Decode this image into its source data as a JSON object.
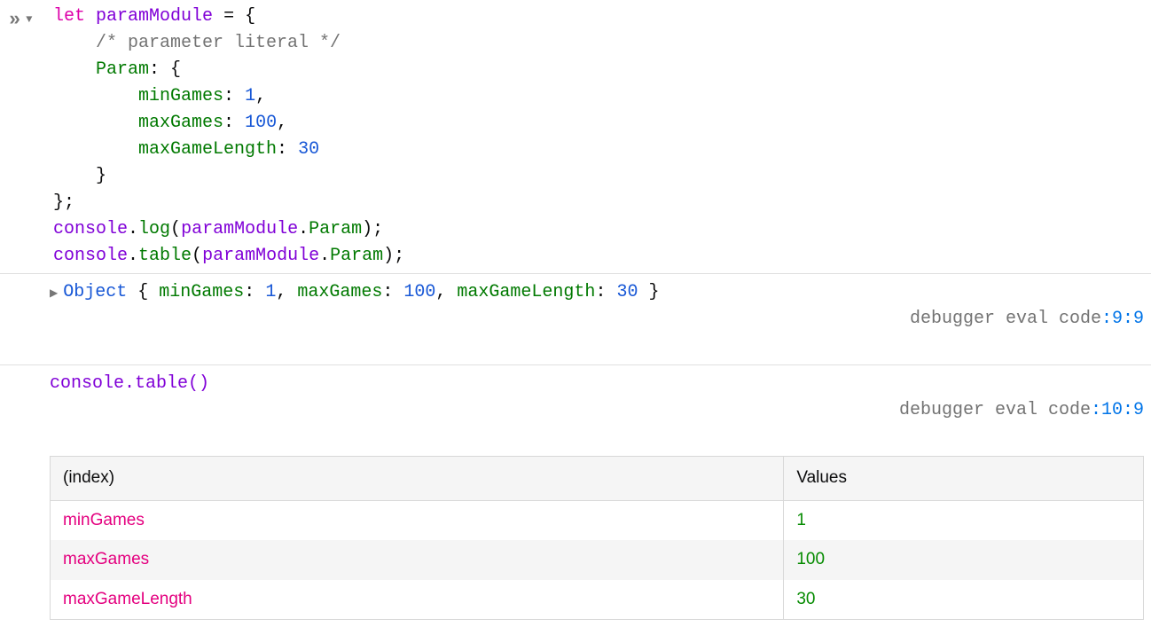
{
  "input": {
    "code_html": "<span class=\"kw\">let</span> <span class=\"var\">paramModule</span> <span class=\"punct\">= {</span>\n    <span class=\"comment\">/* parameter literal */</span>\n    <span class=\"prop\">Param</span><span class=\"punct\">: {</span>\n        <span class=\"prop\">minGames</span><span class=\"punct\">:</span> <span class=\"num\">1</span><span class=\"punct\">,</span>\n        <span class=\"prop\">maxGames</span><span class=\"punct\">:</span> <span class=\"num\">100</span><span class=\"punct\">,</span>\n        <span class=\"prop\">maxGameLength</span><span class=\"punct\">:</span> <span class=\"num\">30</span>\n    <span class=\"punct\">}</span>\n<span class=\"punct\">};</span>\n<span class=\"var\">console</span><span class=\"punct\">.</span><span class=\"prop\">log</span><span class=\"punct\">(</span><span class=\"var\">paramModule</span><span class=\"punct\">.</span><span class=\"prop\">Param</span><span class=\"punct\">);</span>\n<span class=\"var\">console</span><span class=\"punct\">.</span><span class=\"prop\">table</span><span class=\"punct\">(</span><span class=\"var\">paramModule</span><span class=\"punct\">.</span><span class=\"prop\">Param</span><span class=\"punct\">);</span>"
  },
  "log_output": {
    "summary_html": "<span class=\"obj-word\">Object</span> <span class=\"punct\">{ </span><span class=\"prop\">minGames</span><span class=\"punct\">: </span><span class=\"num\">1</span><span class=\"punct\">, </span><span class=\"prop\">maxGames</span><span class=\"punct\">: </span><span class=\"num\">100</span><span class=\"punct\">, </span><span class=\"prop\">maxGameLength</span><span class=\"punct\">: </span><span class=\"num\">30</span><span class=\"punct\"> }</span>",
    "source_prefix": "debugger eval code",
    "source_loc": ":9:9"
  },
  "table_output": {
    "label": "console.table()",
    "source_prefix": "debugger eval code",
    "source_loc": ":10:9",
    "headers": [
      "(index)",
      "Values"
    ],
    "rows": [
      {
        "key": "minGames",
        "value": "1"
      },
      {
        "key": "maxGames",
        "value": "100"
      },
      {
        "key": "maxGameLength",
        "value": "30"
      }
    ]
  },
  "chart_data": {
    "type": "table",
    "title": "console.table()",
    "columns": [
      "(index)",
      "Values"
    ],
    "rows": [
      [
        "minGames",
        1
      ],
      [
        "maxGames",
        100
      ],
      [
        "maxGameLength",
        30
      ]
    ]
  }
}
